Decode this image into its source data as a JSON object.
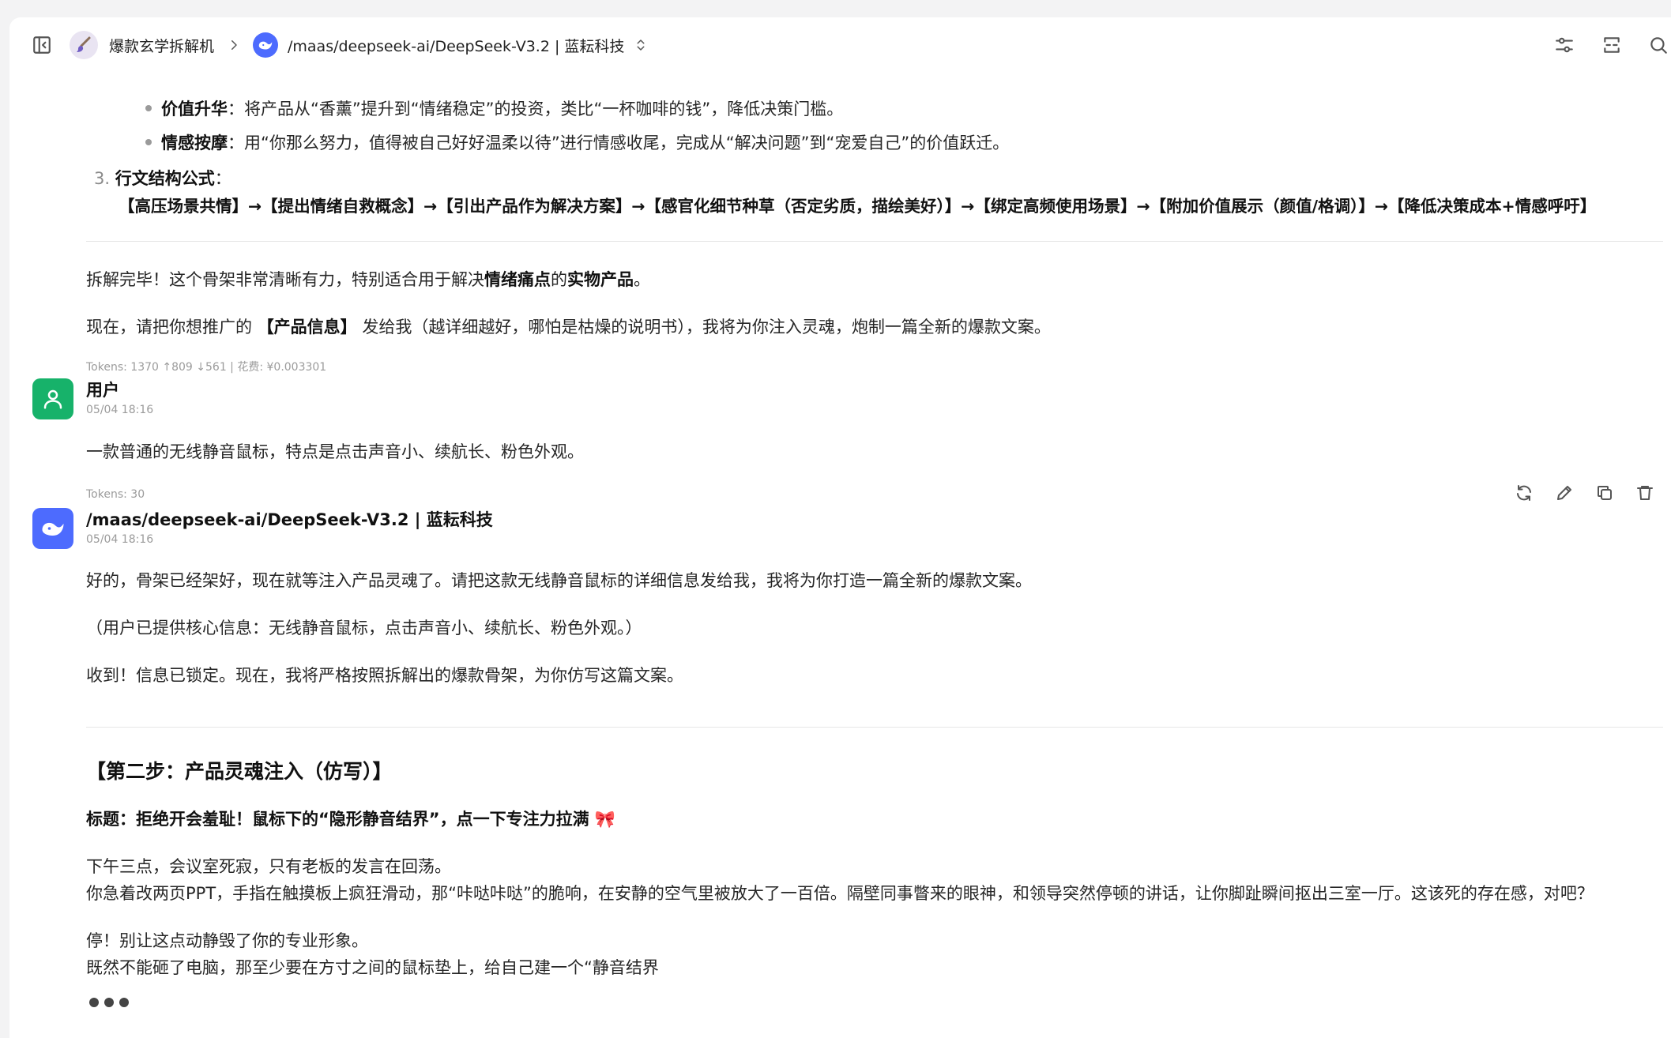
{
  "header": {
    "assistant_name": "爆款玄学拆解机",
    "model_name": "/maas/deepseek-ai/DeepSeek-V3.2 | 蓝耘科技"
  },
  "icons": {
    "sidebar_toggle": "sidebar-toggle-icon",
    "assistant_avatar": "brush-icon",
    "breadcrumb_separator": "chevron-right-icon",
    "model_logo": "deepseek-whale-icon",
    "model_switch": "chevrons-up-down-icon",
    "settings": "sliders-icon",
    "expand": "expand-icon",
    "search": "search-icon",
    "user_avatar": "user-icon",
    "regenerate": "refresh-icon",
    "edit": "pencil-icon",
    "copy": "copy-icon",
    "delete": "trash-icon"
  },
  "colors": {
    "user_avatar_bg": "#17b26a",
    "model_avatar_bg": "#4d6bfe",
    "assistant_avatar_bg": "#e9e4f2"
  },
  "previous_message": {
    "bullet1_label": "价值升华",
    "bullet1_text": "：将产品从“香薰”提升到“情绪稳定”的投资，类比“一杯咖啡的钱”，降低决策门槛。",
    "bullet2_label": "情感按摩",
    "bullet2_text": "：用“你那么努力，值得被自己好好温柔以待”进行情感收尾，完成从“解决问题”到“宠爱自己”的价值跃迁。",
    "item3_number": "3.",
    "item3_label": "行文结构公式",
    "item3_colon": "：",
    "formula": "【高压场景共情】→【提出情绪自救概念】→【引出产品作为解决方案】→【感官化细节种草（否定劣质，描绘美好）】→【绑定高频使用场景】→【附加价值展示（颜值/格调）】→【降低决策成本+情感呼吁】",
    "summary_prefix": "拆解完毕！这个骨架非常清晰有力，特别适合用于解决",
    "summary_bold1": "情绪痛点",
    "summary_mid": "的",
    "summary_bold2": "实物产品",
    "summary_suffix": "。",
    "request_prefix": "现在，请把你想推广的 ",
    "request_bold": "【产品信息】",
    "request_suffix": " 发给我（越详细越好，哪怕是枯燥的说明书），我将为你注入灵魂，炮制一篇全新的爆款文案。",
    "tokens": "Tokens: 1370 ↑809 ↓561 | 花费: ¥0.003301"
  },
  "user_message": {
    "name": "用户",
    "time": "05/04 18:16",
    "text": "一款普通的无线静音鼠标，特点是点击声音小、续航长、粉色外观。",
    "tokens": "Tokens: 30"
  },
  "assistant_message": {
    "name": "/maas/deepseek-ai/DeepSeek-V3.2 | 蓝耘科技",
    "time": "05/04 18:16",
    "p1": "好的，骨架已经架好，现在就等注入产品灵魂了。请把这款无线静音鼠标的详细信息发给我，我将为你打造一篇全新的爆款文案。",
    "p2": "（用户已提供核心信息：无线静音鼠标，点击声音小、续航长、粉色外观。）",
    "p3": "收到！信息已锁定。现在，我将严格按照拆解出的爆款骨架，为你仿写这篇文案。",
    "heading": "【第二步：产品灵魂注入（仿写）】",
    "title_line": "标题：拒绝开会羞耻！鼠标下的“隐形静音结界”，点一下专注力拉满 🎀",
    "body1": "下午三点，会议室死寂，只有老板的发言在回荡。",
    "body2": "你急着改两页PPT，手指在触摸板上疯狂滑动，那“咔哒咔哒”的脆响，在安静的空气里被放大了一百倍。隔壁同事瞥来的眼神，和领导突然停顿的讲话，让你脚趾瞬间抠出三室一厅。这该死的存在感，对吧？",
    "body3": "停！别让这点动静毁了你的专业形象。",
    "body4": "既然不能砸了电脑，那至少要在方寸之间的鼠标垫上，给自己建一个“静音结界"
  }
}
